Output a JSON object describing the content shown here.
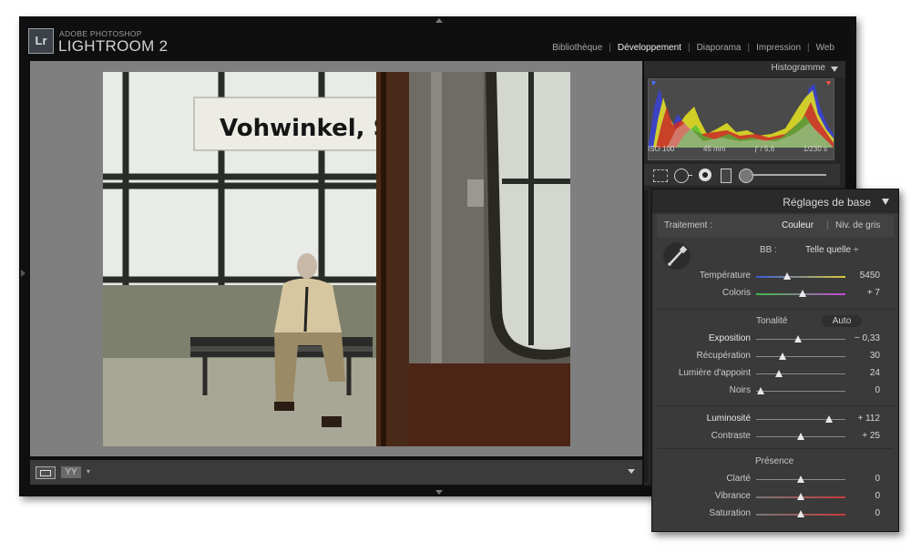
{
  "app": {
    "brand_small": "ADOBE PHOTOSHOP",
    "brand_main": "LIGHTROOM 2",
    "logo_letters": "Lr"
  },
  "modules": [
    {
      "label": "Bibliothèque",
      "active": false
    },
    {
      "label": "Développement",
      "active": true
    },
    {
      "label": "Diaporama",
      "active": false
    },
    {
      "label": "Impression",
      "active": false
    },
    {
      "label": "Web",
      "active": false
    }
  ],
  "photo": {
    "sign_text": "Vohwinkel, Sch"
  },
  "toolbar": {
    "compare_label": "YY"
  },
  "histogram": {
    "title": "Histogramme",
    "iso": "ISO 100",
    "focal": "45 mm",
    "aperture": "ƒ / 5,6",
    "shutter": "1/230 s"
  },
  "basic": {
    "title": "Réglages de base",
    "treatment_label": "Traitement :",
    "treatment_color": "Couleur",
    "treatment_sep": "|",
    "treatment_gray": "Niv. de gris",
    "wb_label": "BB :",
    "wb_value": "Telle quelle ÷",
    "tone_label": "Tonalité",
    "auto_label": "Auto",
    "presence_label": "Présence",
    "sliders": [
      {
        "id": "temperature",
        "label": "Température",
        "value": "5450",
        "pos": 0.35,
        "group": "wb"
      },
      {
        "id": "tint",
        "label": "Coloris",
        "value": "+ 7",
        "pos": 0.52,
        "group": "wb"
      },
      {
        "id": "exposure",
        "label": "Exposition",
        "value": "− 0,33",
        "pos": 0.47,
        "group": "tone"
      },
      {
        "id": "recovery",
        "label": "Récupération",
        "value": "30",
        "pos": 0.3,
        "group": "tone"
      },
      {
        "id": "fill",
        "label": "Lumière d'appoint",
        "value": "24",
        "pos": 0.25,
        "group": "tone"
      },
      {
        "id": "blacks",
        "label": "Noirs",
        "value": "0",
        "pos": 0.05,
        "group": "tone"
      },
      {
        "id": "brightness",
        "label": "Luminosité",
        "value": "+ 112",
        "pos": 0.82,
        "group": "light"
      },
      {
        "id": "contrast",
        "label": "Contraste",
        "value": "+ 25",
        "pos": 0.5,
        "group": "light"
      },
      {
        "id": "clarity",
        "label": "Clarté",
        "value": "0",
        "pos": 0.5,
        "group": "presence"
      },
      {
        "id": "vibrance",
        "label": "Vibrance",
        "value": "0",
        "pos": 0.5,
        "group": "presence"
      },
      {
        "id": "saturation",
        "label": "Saturation",
        "value": "0",
        "pos": 0.5,
        "group": "presence"
      }
    ]
  }
}
